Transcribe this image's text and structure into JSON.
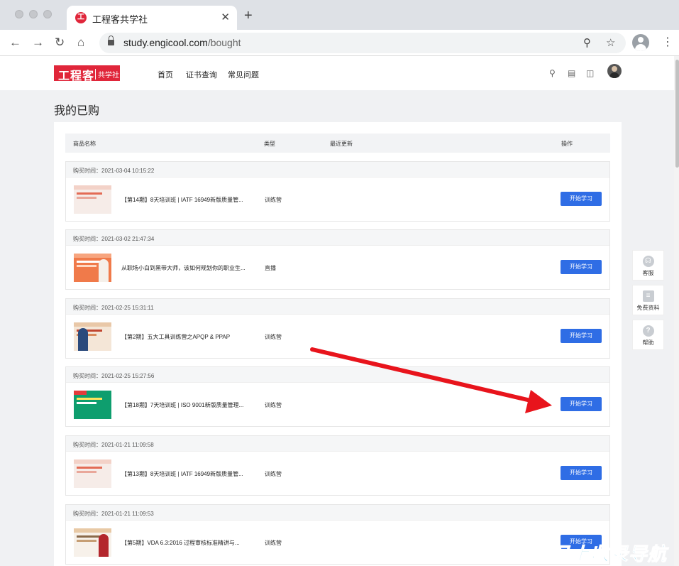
{
  "browser": {
    "tab_title": "工程客共学社",
    "tab_logo_char": "工",
    "url_domain": "study.engicool.com",
    "url_path": "/bought"
  },
  "site": {
    "logo_main": "工程客",
    "logo_sub": "共学社",
    "nav": [
      "首页",
      "证书查询",
      "常见问题"
    ]
  },
  "page": {
    "title": "我的已购",
    "columns": [
      "商品名称",
      "类型",
      "最近更新",
      "操作"
    ],
    "orders": [
      {
        "time_label": "购买时间：2021-03-04 10:15:22",
        "name": "【第14期】8天培训班 | IATF 16949新版质量管...",
        "type": "训练营",
        "action": "开始学习",
        "thumb": "light"
      },
      {
        "time_label": "购买时间：2021-03-02 21:47:34",
        "name": "从职场小白到黑带大师，该如何规划你的职业生...",
        "type": "直播",
        "action": "开始学习",
        "thumb": "orange"
      },
      {
        "time_label": "购买时间：2021-02-25 15:31:11",
        "name": "【第2期】五大工具训练营之APQP & PPAP",
        "type": "训练营",
        "action": "开始学习",
        "thumb": "person"
      },
      {
        "time_label": "购买时间：2021-02-25 15:27:56",
        "name": "【第18期】7天培训班 | ISO 9001新版质量管理...",
        "type": "训练营",
        "action": "开始学习",
        "thumb": "green"
      },
      {
        "time_label": "购买时间：2021-01-21 11:09:58",
        "name": "【第13期】8天培训班 | IATF 16949新版质量管...",
        "type": "训练营",
        "action": "开始学习",
        "thumb": "light"
      },
      {
        "time_label": "购买时间：2021-01-21 11:09:53",
        "name": "【第5期】VDA 6.3:2016 过程审核标准精讲与...",
        "type": "训练营",
        "action": "开始学习",
        "thumb": "pale"
      }
    ]
  },
  "sidebar_float": [
    {
      "label": "客服",
      "icon": "headset-icon"
    },
    {
      "label": "免费资料",
      "icon": "document-icon"
    },
    {
      "label": "帮助",
      "icon": "help-icon"
    }
  ],
  "watermark": "马上收录导航",
  "colors": {
    "brand_red": "#e0263a",
    "button_blue": "#2f6de5",
    "annotation_arrow": "#e8141c"
  }
}
